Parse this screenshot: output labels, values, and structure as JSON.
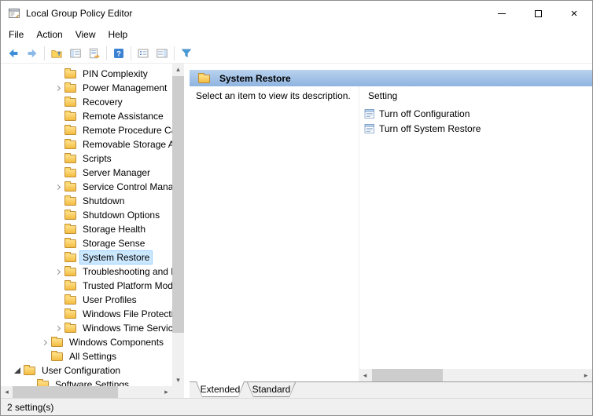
{
  "window": {
    "title": "Local Group Policy Editor",
    "controls": [
      "minimize",
      "maximize",
      "close"
    ]
  },
  "menubar": {
    "items": [
      "File",
      "Action",
      "View",
      "Help"
    ]
  },
  "toolbar": {
    "buttons": [
      "back",
      "forward",
      "up-one-level",
      "show-hide-console-tree",
      "export-list",
      "help",
      "details-list",
      "show-hide-action-pane",
      "filter"
    ]
  },
  "tree": {
    "items": [
      {
        "label": "PIN Complexity",
        "level": 4,
        "chevron": "none",
        "selected": false
      },
      {
        "label": "Power Management",
        "level": 4,
        "chevron": "collapsed",
        "selected": false
      },
      {
        "label": "Recovery",
        "level": 4,
        "chevron": "none",
        "selected": false
      },
      {
        "label": "Remote Assistance",
        "level": 4,
        "chevron": "none",
        "selected": false
      },
      {
        "label": "Remote Procedure Cal",
        "level": 4,
        "chevron": "none",
        "selected": false
      },
      {
        "label": "Removable Storage Ac",
        "level": 4,
        "chevron": "none",
        "selected": false
      },
      {
        "label": "Scripts",
        "level": 4,
        "chevron": "none",
        "selected": false
      },
      {
        "label": "Server Manager",
        "level": 4,
        "chevron": "none",
        "selected": false
      },
      {
        "label": "Service Control Manag",
        "level": 4,
        "chevron": "collapsed",
        "selected": false
      },
      {
        "label": "Shutdown",
        "level": 4,
        "chevron": "none",
        "selected": false
      },
      {
        "label": "Shutdown Options",
        "level": 4,
        "chevron": "none",
        "selected": false
      },
      {
        "label": "Storage Health",
        "level": 4,
        "chevron": "none",
        "selected": false
      },
      {
        "label": "Storage Sense",
        "level": 4,
        "chevron": "none",
        "selected": false
      },
      {
        "label": "System Restore",
        "level": 4,
        "chevron": "none",
        "selected": true
      },
      {
        "label": "Troubleshooting and D",
        "level": 4,
        "chevron": "collapsed",
        "selected": false
      },
      {
        "label": "Trusted Platform Mod",
        "level": 4,
        "chevron": "none",
        "selected": false
      },
      {
        "label": "User Profiles",
        "level": 4,
        "chevron": "none",
        "selected": false
      },
      {
        "label": "Windows File Protectio",
        "level": 4,
        "chevron": "none",
        "selected": false
      },
      {
        "label": "Windows Time Service",
        "level": 4,
        "chevron": "collapsed",
        "selected": false
      },
      {
        "label": "Windows Components",
        "level": 3,
        "chevron": "collapsed",
        "selected": false
      },
      {
        "label": "All Settings",
        "level": 3,
        "chevron": "none",
        "selected": false
      },
      {
        "label": "User Configuration",
        "level": 1,
        "chevron": "expanded",
        "selected": false
      },
      {
        "label": "Software Settings",
        "level": 2,
        "chevron": "none",
        "selected": false
      }
    ]
  },
  "results": {
    "header": "System Restore",
    "description": "Select an item to view its description.",
    "column_header": "Setting",
    "settings": [
      "Turn off Configuration",
      "Turn off System Restore"
    ]
  },
  "tabs": {
    "items": [
      {
        "label": "Extended",
        "selected": true
      },
      {
        "label": "Standard",
        "selected": false
      }
    ]
  },
  "statusbar": {
    "text": "2 setting(s)"
  },
  "colors": {
    "selection_bg": "#cce8ff",
    "selection_border": "#99d1ff",
    "results_header_top": "#b9d2ee",
    "results_header_bottom": "#8fb4e0",
    "folder_top": "#ffe08a",
    "folder_bottom": "#f3bc3f",
    "accent_blue": "#3f8fd8"
  }
}
